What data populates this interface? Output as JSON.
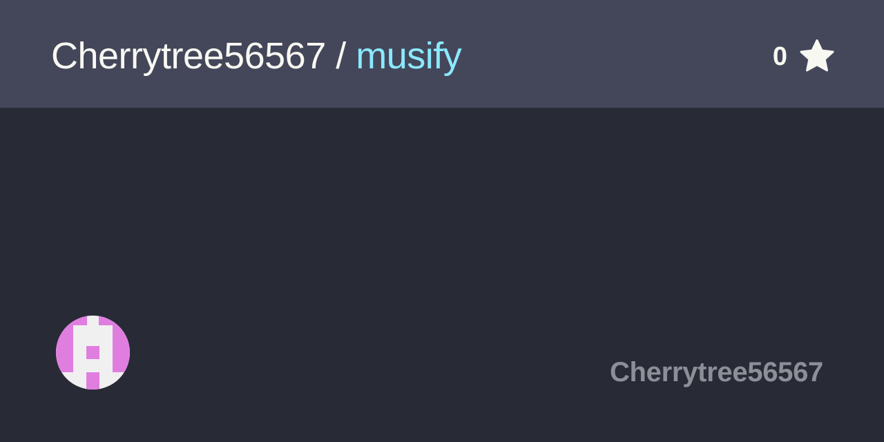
{
  "header": {
    "owner": "Cherrytree56567",
    "separator": "/",
    "repo": "musify"
  },
  "stars": {
    "count": "0",
    "icon": "star-icon"
  },
  "footer": {
    "username": "Cherrytree56567",
    "avatar_icon": "identicon-avatar"
  },
  "colors": {
    "background": "#282a36",
    "header_background": "#44475a",
    "owner_text": "#f8f8f2",
    "repo_text": "#8be9fd",
    "footer_text": "#8d8f98",
    "avatar_accent": "#e07ee0",
    "avatar_background": "#f0f0f0"
  }
}
